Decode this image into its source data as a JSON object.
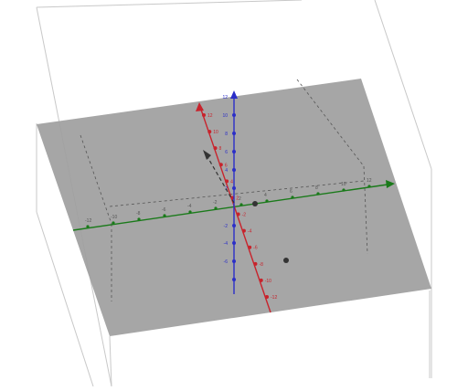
{
  "view": {
    "type": "3d-graphics-view",
    "background": "#ffffff",
    "box_color": "#c8c8c8",
    "plane_color": "#9e9e9e",
    "dashed_color": "#666666"
  },
  "axes": {
    "x": {
      "color": "#c8232c",
      "label_color": "#c8232c",
      "ticks": [
        "12",
        "10",
        "8",
        "6",
        "4",
        "2",
        "-2",
        "-4",
        "-6",
        "-8",
        "-10",
        "-12"
      ]
    },
    "y": {
      "color": "#1a7a1a",
      "ticks": [
        "-12",
        "-10",
        "-8",
        "-6",
        "-4",
        "-2",
        "2",
        "4",
        "6",
        "8",
        "10",
        "12"
      ]
    },
    "z": {
      "color": "#2b2ec8",
      "ticks": [
        "12",
        "10",
        "8",
        "6",
        "4",
        "2",
        "-2",
        "-4",
        "-6"
      ]
    }
  },
  "objects": {
    "point_a": {
      "color": "#333333"
    },
    "point_b": {
      "color": "#333333"
    },
    "vector": {
      "color": "#333333"
    }
  }
}
